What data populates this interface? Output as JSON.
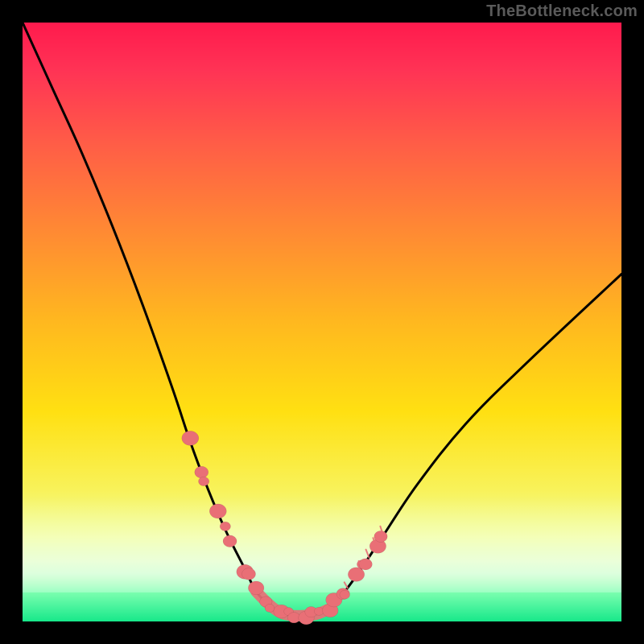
{
  "watermark": "TheBottleneck.com",
  "colors": {
    "marker": "#e96f76",
    "curve": "#000000",
    "frame": "#000000"
  },
  "chart_data": {
    "type": "line",
    "title": "",
    "xlabel": "",
    "ylabel": "",
    "xlim": [
      0,
      100
    ],
    "ylim": [
      0,
      100
    ],
    "legend": false,
    "grid": false,
    "series": [
      {
        "name": "bottleneck-curve",
        "x": [
          0,
          5,
          10,
          15,
          20,
          25,
          28,
          31,
          34,
          37,
          39,
          41,
          43,
          45,
          47,
          49,
          51,
          53,
          56,
          60,
          66,
          74,
          84,
          100
        ],
        "y": [
          100,
          89,
          78,
          66,
          53,
          39,
          30,
          22,
          15,
          9,
          5,
          3,
          1.5,
          1,
          1,
          1.2,
          2,
          4,
          8,
          14,
          23,
          33,
          43,
          58
        ]
      }
    ],
    "marker_clusters": [
      {
        "name": "left-descent-beads",
        "x_range": [
          28,
          38
        ],
        "y_range": [
          8,
          28
        ],
        "count": 8
      },
      {
        "name": "valley-beads",
        "x_range": [
          39,
          51
        ],
        "y_range": [
          0.5,
          3
        ],
        "count": 10
      },
      {
        "name": "right-ascent-beads",
        "x_range": [
          52,
          60
        ],
        "y_range": [
          5,
          18
        ],
        "count": 8
      }
    ]
  }
}
